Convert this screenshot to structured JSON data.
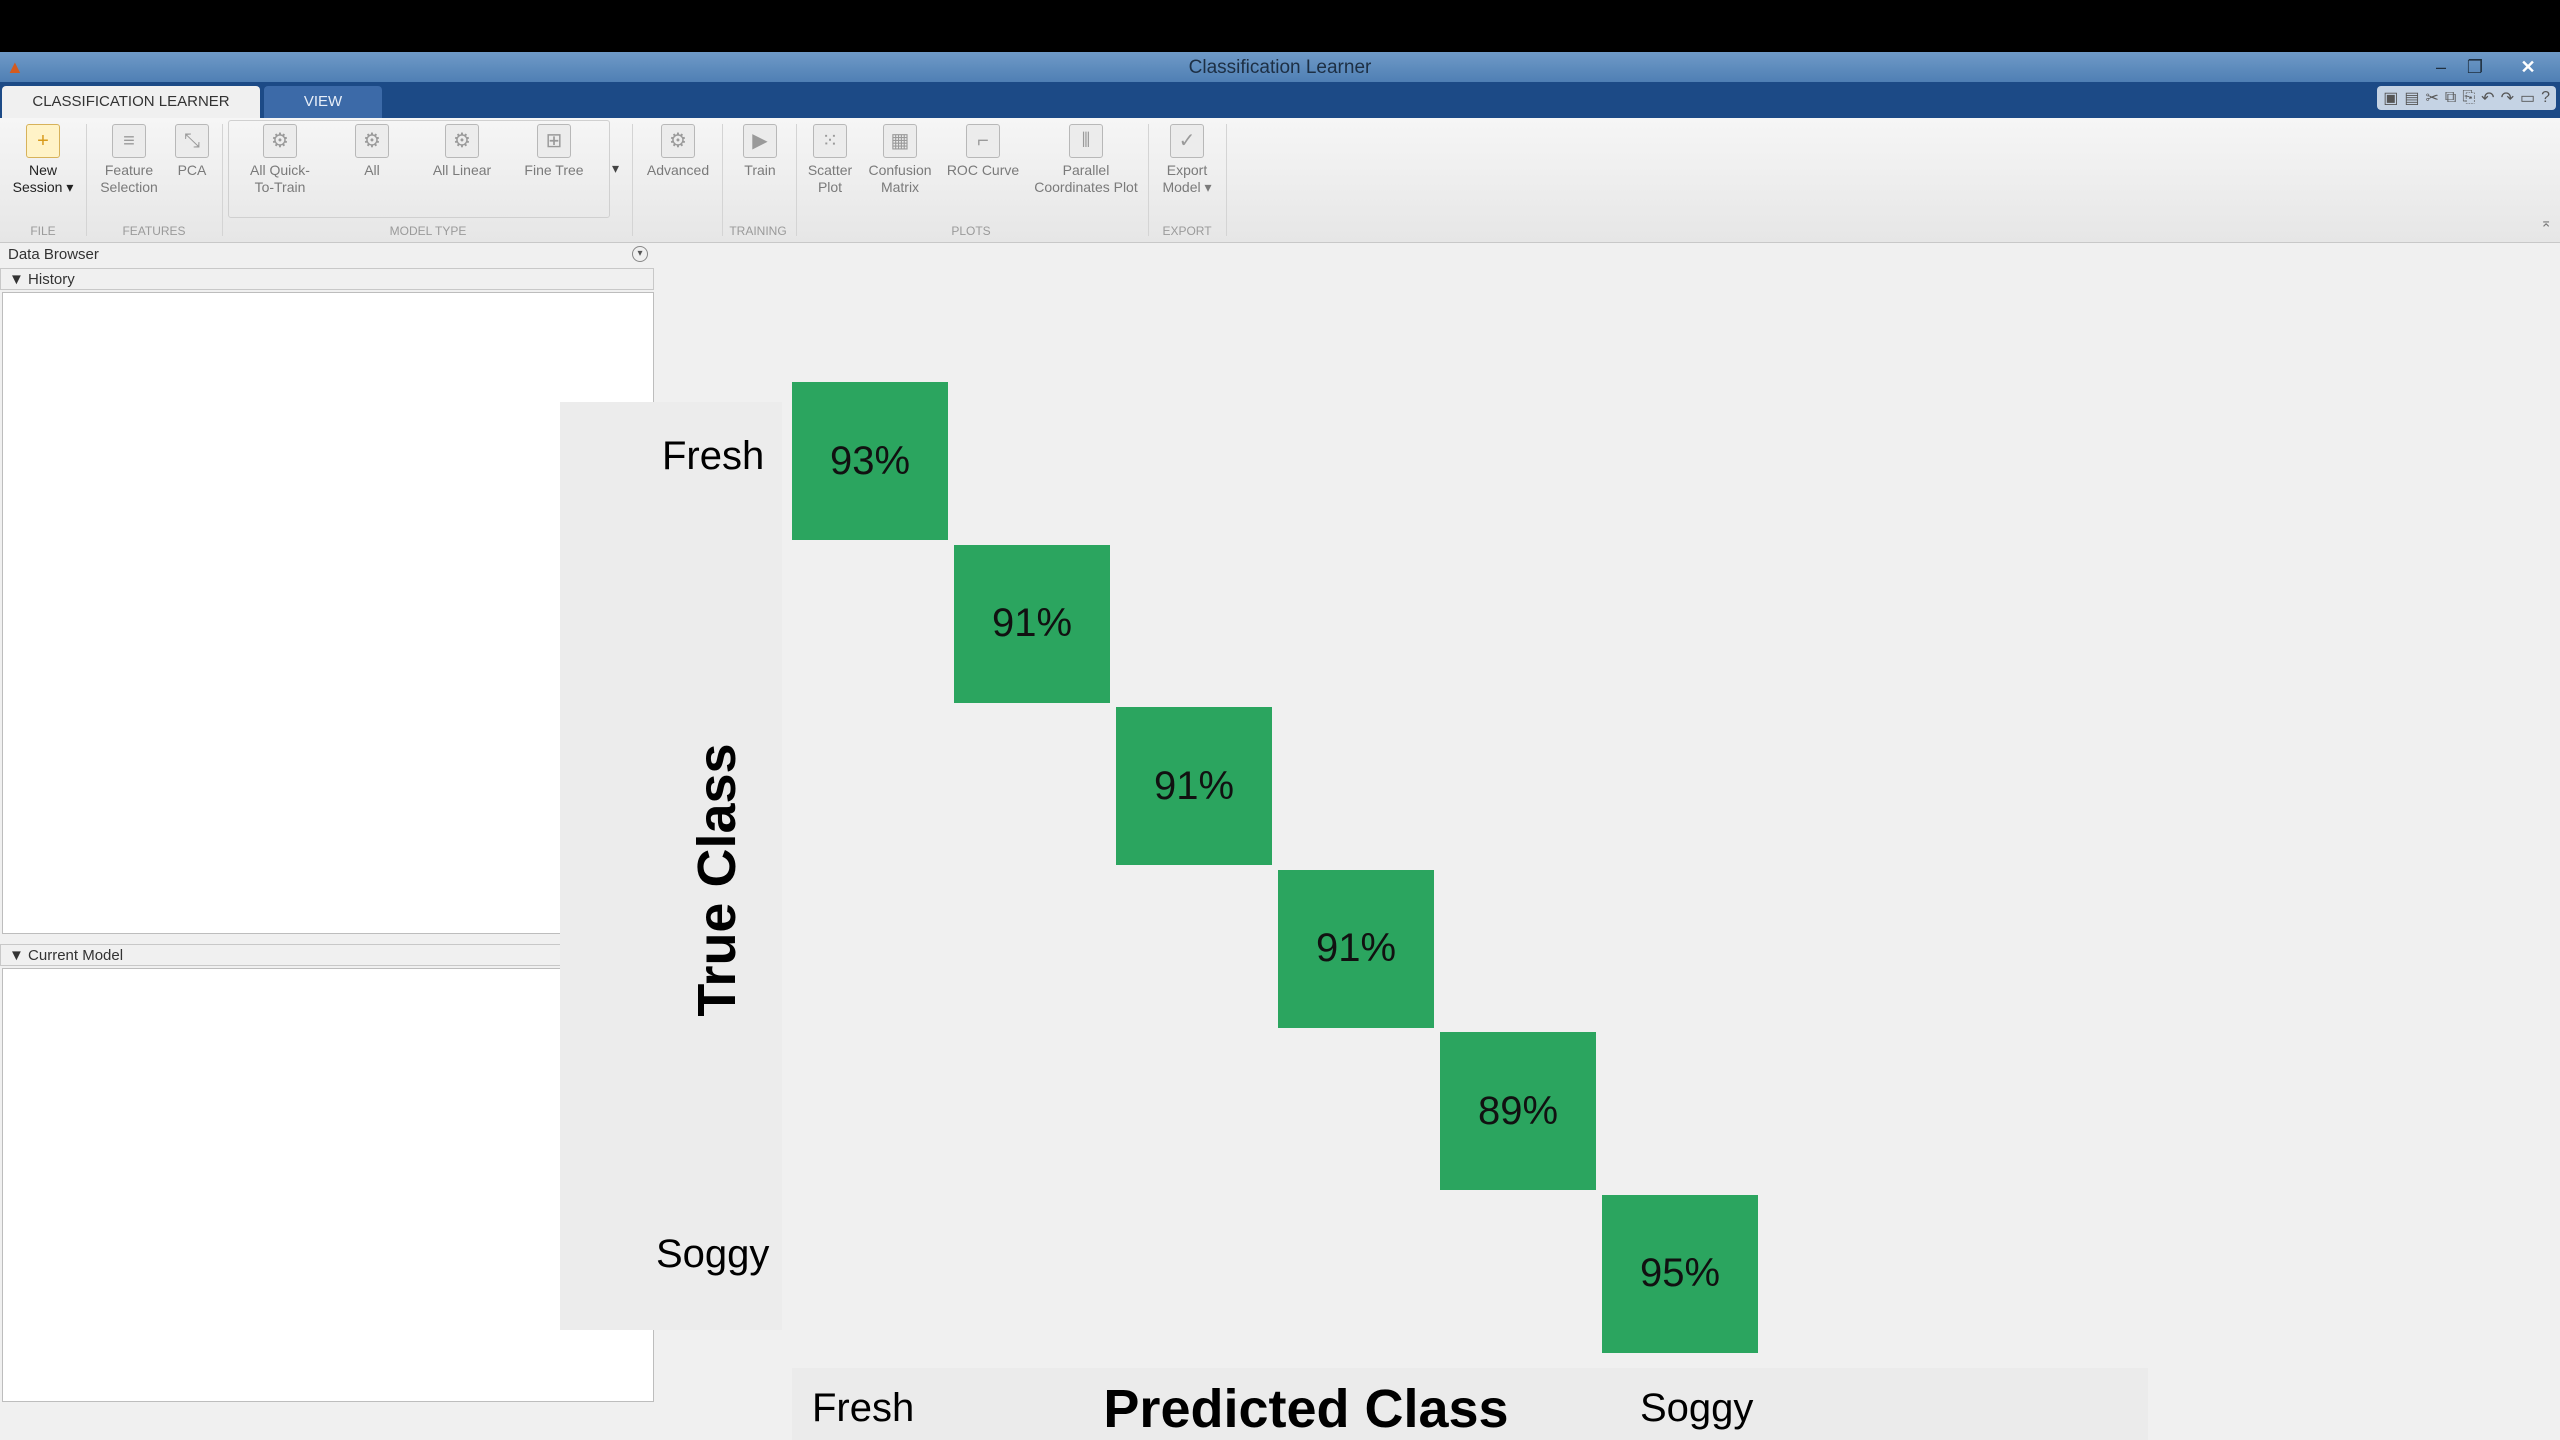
{
  "window": {
    "title": "Classification Learner"
  },
  "tabs": [
    {
      "label": "CLASSIFICATION LEARNER"
    },
    {
      "label": "VIEW"
    }
  ],
  "ribbon": {
    "buttons": [
      {
        "label": "New",
        "label2": "Session ▾",
        "icon": "plus-icon"
      },
      {
        "label": "Feature",
        "label2": "Selection",
        "icon": "list-icon"
      },
      {
        "label": "PCA",
        "label2": "",
        "icon": "pca-icon"
      },
      {
        "label": "All Quick-",
        "label2": "To-Train",
        "icon": "gallery-icon"
      },
      {
        "label": "All",
        "label2": "",
        "icon": "gallery-icon"
      },
      {
        "label": "All Linear",
        "label2": "",
        "icon": "gallery-icon"
      },
      {
        "label": "Fine Tree",
        "label2": "",
        "icon": "tree-icon"
      },
      {
        "label": "Advanced",
        "label2": "",
        "icon": "gear-icon"
      },
      {
        "label": "Train",
        "label2": "",
        "icon": "play-icon"
      },
      {
        "label": "Scatter",
        "label2": "Plot",
        "icon": "scatter-icon"
      },
      {
        "label": "Confusion",
        "label2": "Matrix",
        "icon": "grid-icon"
      },
      {
        "label": "ROC Curve",
        "label2": "",
        "icon": "roc-icon"
      },
      {
        "label": "Parallel",
        "label2": "Coordinates Plot",
        "icon": "parallel-icon"
      },
      {
        "label": "Export",
        "label2": "Model ▾",
        "icon": "check-icon"
      }
    ],
    "groups": [
      "FILE",
      "FEATURES",
      "MODEL TYPE",
      "TRAINING",
      "PLOTS",
      "EXPORT"
    ]
  },
  "sidebar": {
    "data_browser_title": "Data Browser",
    "history_label": "History",
    "current_model_label": "Current Model"
  },
  "chart_data": {
    "type": "heatmap",
    "xlabel": "Predicted Class",
    "ylabel": "True Class",
    "x_tick_labels": [
      "Fresh",
      "Soggy"
    ],
    "y_tick_labels": [
      "Fresh",
      "Soggy"
    ],
    "diagonal_values": [
      "93%",
      "91%",
      "91%",
      "91%",
      "89%",
      "95%"
    ],
    "cell_color": "#2ba55f"
  }
}
